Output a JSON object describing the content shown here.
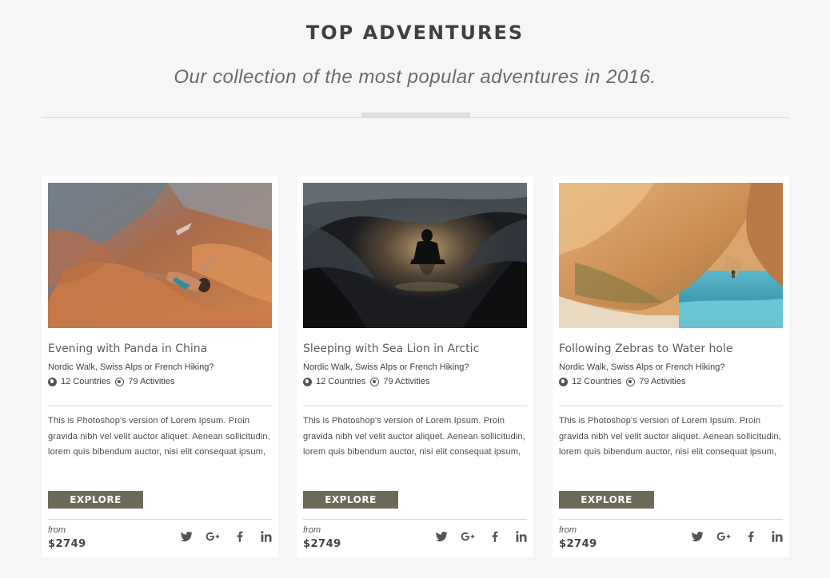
{
  "header": {
    "title": "TOP ADVENTURES",
    "subtitle": "Our collection of the most popular adventures in 2016."
  },
  "colors": {
    "background": "#f6f6f6",
    "card": "#ffffff",
    "button": "#6c6a58",
    "title": "#3f4140"
  },
  "cards": [
    {
      "title": "Evening with Panda in China",
      "subtitle": "Nordic Walk, Swiss Alps or French Hiking?",
      "countries": "12 Countries",
      "activities": "79 Activities",
      "description": "This is Photoshop's version of Lorem Ipsum. Proin gravida nibh vel velit auctor aliquet. Aenean sollicitudin, lorem quis bibendum auctor, nisi elit consequat ipsum,",
      "button": "EXPLORE",
      "from_label": "from",
      "price": "$2749",
      "image": "rock-climber-photo"
    },
    {
      "title": "Sleeping with Sea Lion in Arctic",
      "subtitle": "Nordic Walk, Swiss Alps or French Hiking?",
      "countries": "12 Countries",
      "activities": "79 Activities",
      "description": "This is Photoshop's version of Lorem Ipsum. Proin gravida nibh vel velit auctor aliquet. Aenean sollicitudin, lorem quis bibendum auctor, nisi elit consequat ipsum,",
      "button": "EXPLORE",
      "from_label": "from",
      "price": "$2749",
      "image": "cave-explorer-photo"
    },
    {
      "title": "Following Zebras to Water hole",
      "subtitle": "Nordic Walk, Swiss Alps or French Hiking?",
      "countries": "12 Countries",
      "activities": "79 Activities",
      "description": "This is Photoshop's version of Lorem Ipsum. Proin gravida nibh vel velit auctor aliquet. Aenean sollicitudin, lorem quis bibendum auctor, nisi elit consequat ipsum,",
      "button": "EXPLORE",
      "from_label": "from",
      "price": "$2749",
      "image": "beach-boulders-photo"
    }
  ],
  "social_icons": [
    "twitter-icon",
    "google-plus-icon",
    "facebook-icon",
    "linkedin-icon"
  ],
  "meta_icons": [
    "globe-icon",
    "at-icon"
  ]
}
